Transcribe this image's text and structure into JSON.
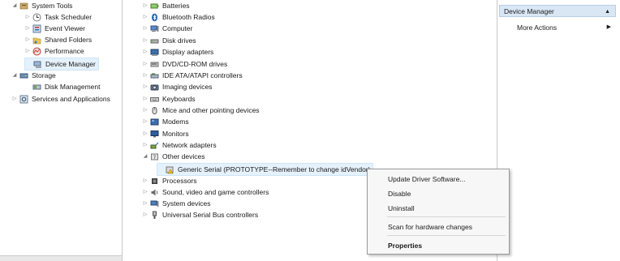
{
  "left_tree": {
    "items": [
      {
        "label": "System Tools",
        "icon": "system-tools-icon",
        "expander": "◢"
      },
      {
        "label": "Task Scheduler",
        "icon": "clock-icon",
        "expander": "▷"
      },
      {
        "label": "Event Viewer",
        "icon": "event-viewer-icon",
        "expander": "▷"
      },
      {
        "label": "Shared Folders",
        "icon": "shared-folder-icon",
        "expander": "▷"
      },
      {
        "label": "Performance",
        "icon": "performance-icon",
        "expander": "▷"
      },
      {
        "label": "Device Manager",
        "icon": "device-manager-icon",
        "expander": ""
      },
      {
        "label": "Storage",
        "icon": "storage-icon",
        "expander": "◢"
      },
      {
        "label": "Disk Management",
        "icon": "disk-icon",
        "expander": ""
      },
      {
        "label": "Services and Applications",
        "icon": "services-icon",
        "expander": "▷"
      }
    ]
  },
  "device_tree": {
    "items": [
      {
        "label": "Batteries",
        "icon": "battery-icon",
        "expander": "▷"
      },
      {
        "label": "Bluetooth Radios",
        "icon": "bluetooth-icon",
        "expander": "▷"
      },
      {
        "label": "Computer",
        "icon": "computer-icon",
        "expander": "▷"
      },
      {
        "label": "Disk drives",
        "icon": "disk-drive-icon",
        "expander": "▷"
      },
      {
        "label": "Display adapters",
        "icon": "display-adapter-icon",
        "expander": "▷"
      },
      {
        "label": "DVD/CD-ROM drives",
        "icon": "dvd-icon",
        "expander": "▷"
      },
      {
        "label": "IDE ATA/ATAPI controllers",
        "icon": "ide-controller-icon",
        "expander": "▷"
      },
      {
        "label": "Imaging devices",
        "icon": "camera-icon",
        "expander": "▷"
      },
      {
        "label": "Keyboards",
        "icon": "keyboard-icon",
        "expander": "▷"
      },
      {
        "label": "Mice and other pointing devices",
        "icon": "mouse-icon",
        "expander": "▷"
      },
      {
        "label": "Modems",
        "icon": "modem-icon",
        "expander": "▷"
      },
      {
        "label": "Monitors",
        "icon": "monitor-icon",
        "expander": "▷"
      },
      {
        "label": "Network adapters",
        "icon": "network-icon",
        "expander": "▷"
      },
      {
        "label": "Other devices",
        "icon": "other-devices-icon",
        "expander": "◢"
      },
      {
        "label": "Generic Serial (PROTOTYPE--Remember to change idVendor)",
        "icon": "warning-device-icon",
        "expander": ""
      },
      {
        "label": "Processors",
        "icon": "processor-icon",
        "expander": "▷"
      },
      {
        "label": "Sound, video and game controllers",
        "icon": "sound-icon",
        "expander": "▷"
      },
      {
        "label": "System devices",
        "icon": "system-devices-icon",
        "expander": "▷"
      },
      {
        "label": "Universal Serial Bus controllers",
        "icon": "usb-icon",
        "expander": "▷"
      }
    ]
  },
  "actions": {
    "header": "Device Manager",
    "more_actions": "More Actions"
  },
  "context_menu": {
    "update": "Update Driver Software...",
    "disable": "Disable",
    "uninstall": "Uninstall",
    "scan": "Scan for hardware changes",
    "properties": "Properties"
  },
  "colors": {
    "selection": "#e5f1fb",
    "actions_header": "#d9e7f5",
    "menu_background": "#f7f7f7"
  }
}
